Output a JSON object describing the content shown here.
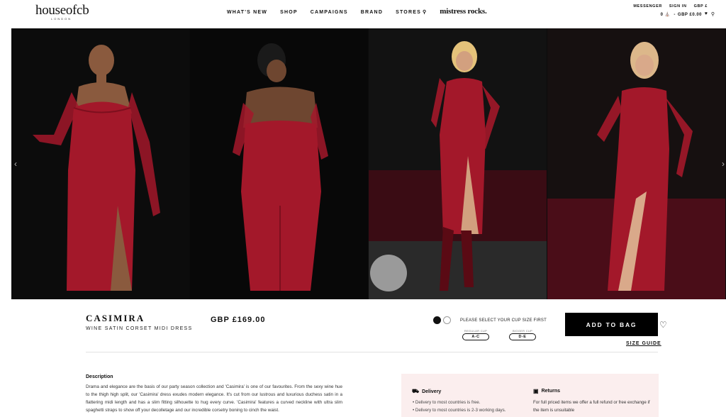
{
  "header": {
    "logo": "houseofcb",
    "logo_sub": "LONDON",
    "nav": [
      "WHAT'S NEW",
      "SHOP",
      "CAMPAIGNS",
      "BRAND",
      "STORES"
    ],
    "brand_link": "mistress rocks.",
    "top_links": [
      "MESSENGER",
      "SIGN IN",
      "GBP £"
    ],
    "bag_count": "0",
    "bag_total": "GBP £0.00",
    "icons": [
      "pin-icon",
      "bag-icon",
      "heart-icon",
      "search-icon"
    ]
  },
  "gallery": {
    "images": [
      "front-view",
      "back-view",
      "model-with-glass",
      "model-with-glass-2"
    ],
    "accent_color": "#a3182a"
  },
  "product": {
    "name": "CASIMIRA",
    "subtitle": "WINE SATIN CORSET MIDI DRESS",
    "price": "GBP £169.00",
    "cup_message": "PLEASE SELECT YOUR CUP SIZE FIRST",
    "cup_options": [
      {
        "caption": "REGULAR CUP",
        "label": "A-C"
      },
      {
        "caption": "BIGGER CUP",
        "label": "D-E"
      }
    ],
    "add_to_bag": "ADD TO BAG",
    "size_guide": "SIZE GUIDE"
  },
  "description": {
    "title": "Description",
    "text": "Drama and elegance are the basis of our party season collection and 'Casimira' is one of our favourites. From the sexy wine hue to the thigh high split, our 'Casimira' dress exudes modern elegance. It's cut from our lustrous and luxurious duchess satin in a flattering midi length and has a slim fitting silhouette to hug every curve. 'Casimira' features a curved neckline with ultra slim spaghetti straps to show off your decolletage and our incredible corsetry boning to cinch the waist."
  },
  "delivery": {
    "title": "Delivery",
    "items": [
      "Delivery to most countries is free.",
      "Delivery to most countries is 2-3 working days."
    ],
    "returns_title": "Returns",
    "returns_text": "For full priced items we offer a full refund or free exchange if the item is unsuitable"
  }
}
